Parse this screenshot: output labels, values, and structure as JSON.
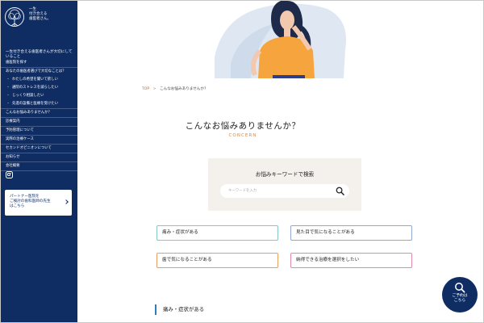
{
  "site": {
    "logo_lines": [
      "一生",
      "付き合える",
      "歯医者さん。"
    ]
  },
  "sidebar": {
    "lead": "一生付き合える歯医者さんが大切にしていること",
    "menu": [
      {
        "label": "歯医院を探す",
        "sub": false
      },
      {
        "label": "あなたの歯医者選びで大切なことは？",
        "sub": false
      },
      {
        "label": "わたしの希望を聞いて欲しい",
        "sub": true
      },
      {
        "label": "通院のストレスを減らしたい",
        "sub": true
      },
      {
        "label": "じっくり相談したい",
        "sub": true
      },
      {
        "label": "先進の設備と医療を受けたい",
        "sub": true
      },
      {
        "label": "こんなお悩みありませんか？",
        "sub": false
      },
      {
        "label": "診療案内",
        "sub": false
      },
      {
        "label": "予防管理について",
        "sub": false
      },
      {
        "label": "実際の治療ケース",
        "sub": false
      },
      {
        "label": "セカンドオピニオンについて",
        "sub": false
      },
      {
        "label": "お知らせ",
        "sub": false
      },
      {
        "label": "会社概要",
        "sub": false
      }
    ],
    "partner_lines": [
      "パートナー医院を",
      "ご検討の歯科医師の先生",
      "はこちら"
    ]
  },
  "breadcrumb": {
    "top": "TOP",
    "separator": ">",
    "current": "こんなお悩みありませんか？"
  },
  "page": {
    "title": "こんなお悩みありませんか？",
    "subtitle": "CONCERN"
  },
  "search": {
    "heading": "お悩みキーワードで検索",
    "value": "",
    "placeholder": "キーワードを入力"
  },
  "categories": [
    {
      "label": "痛み・症状がある",
      "color": "#88c6c8"
    },
    {
      "label": "見た目で気になることがある",
      "color": "#8fa9d4"
    },
    {
      "label": "歯で気になることがある",
      "color": "#e4a063"
    },
    {
      "label": "納得できる治療を選択をしたい",
      "color": "#e08aa6"
    }
  ],
  "section": {
    "heading": "痛み・症状がある"
  },
  "reserve": {
    "lines": [
      "ご予約は",
      "こちら"
    ]
  },
  "colors": {
    "navy": "#0f2d63",
    "accent_orange": "#d58a4c",
    "section_blue": "#2d7ec1"
  },
  "icons": {
    "logo": "tree-icon",
    "instagram": "instagram-icon",
    "search": "search-icon",
    "partner": "chevron-right-icon"
  }
}
